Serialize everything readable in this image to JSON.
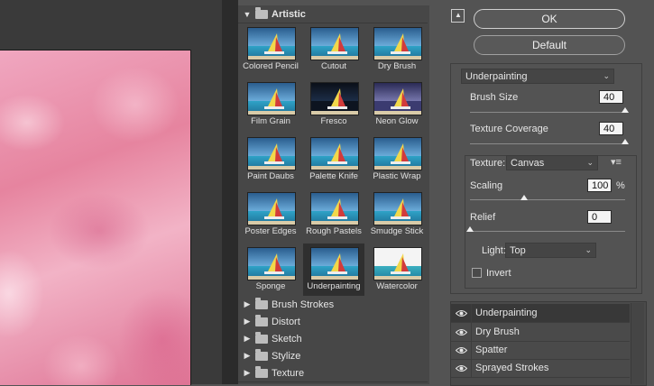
{
  "gallery": {
    "categories": [
      {
        "label": "Artistic",
        "expanded": true
      },
      {
        "label": "Brush Strokes",
        "expanded": false
      },
      {
        "label": "Distort",
        "expanded": false
      },
      {
        "label": "Sketch",
        "expanded": false
      },
      {
        "label": "Stylize",
        "expanded": false
      },
      {
        "label": "Texture",
        "expanded": false
      }
    ],
    "artistic_filters": [
      "Colored Pencil",
      "Cutout",
      "Dry Brush",
      "Film Grain",
      "Fresco",
      "Neon Glow",
      "Paint Daubs",
      "Palette Knife",
      "Plastic Wrap",
      "Poster Edges",
      "Rough Pastels",
      "Smudge Stick",
      "Sponge",
      "Underpainting",
      "Watercolor"
    ],
    "selected_filter": "Underpainting"
  },
  "buttons": {
    "ok": "OK",
    "default": "Default"
  },
  "settings": {
    "filter_select": "Underpainting",
    "brush_size": {
      "label": "Brush Size",
      "value": "40",
      "level": 1.0
    },
    "texture_coverage": {
      "label": "Texture Coverage",
      "value": "40",
      "level": 1.0
    },
    "texture": {
      "label": "Texture:",
      "value": "Canvas"
    },
    "scaling": {
      "label": "Scaling",
      "value": "100",
      "unit": "%",
      "level": 0.35
    },
    "relief": {
      "label": "Relief",
      "value": "0",
      "level": 0.0
    },
    "light": {
      "label": "Light:",
      "value": "Top"
    },
    "invert": {
      "label": "Invert",
      "checked": false
    }
  },
  "layers": [
    {
      "name": "Underpainting",
      "visible": true,
      "active": true
    },
    {
      "name": "Dry Brush",
      "visible": true,
      "active": false
    },
    {
      "name": "Spatter",
      "visible": true,
      "active": false
    },
    {
      "name": "Sprayed Strokes",
      "visible": true,
      "active": false
    }
  ],
  "colors": {
    "panel": "#535353",
    "gallery": "#474747",
    "preview_pink": "#e6849f"
  }
}
